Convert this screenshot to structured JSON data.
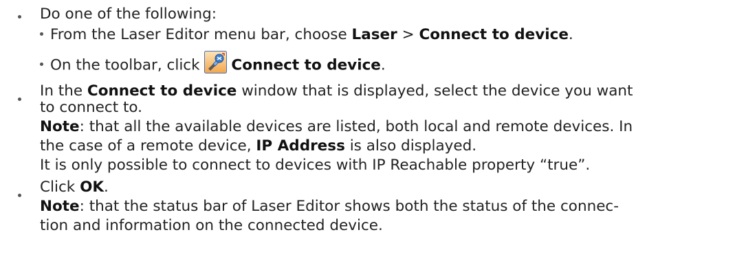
{
  "steps": [
    {
      "intro": "Do one of the following:",
      "options": [
        {
          "prefix": "From the Laser Editor menu bar, choose ",
          "menu": "Laser",
          "separator": " > ",
          "command": "Connect to device",
          "suffix": "."
        },
        {
          "prefix": "On the toolbar, click ",
          "icon": "connect-to-device-icon",
          "command": "Connect to device",
          "suffix": "."
        }
      ]
    },
    {
      "line1_prefix": "In the ",
      "window_name": "Connect to device",
      "line1_suffix": " window that is displayed, select the device you want",
      "line2": "to connect to.",
      "note_label": "Note",
      "note_text": ": that all the available devices are listed, both local and remote devices. In",
      "note_line2_prefix": "the case of a remote device, ",
      "ip_label": "IP Address",
      "note_line2_suffix": " is also displayed.",
      "line5": "It is only possible to connect to devices with IP Reachable property “true”."
    },
    {
      "prefix": "Click ",
      "button": "OK",
      "suffix": ".",
      "note_label": "Note",
      "note_text": ": that the status bar of Laser Editor shows both the status of the connec-",
      "note_line2": "tion and information on the connected device."
    }
  ]
}
